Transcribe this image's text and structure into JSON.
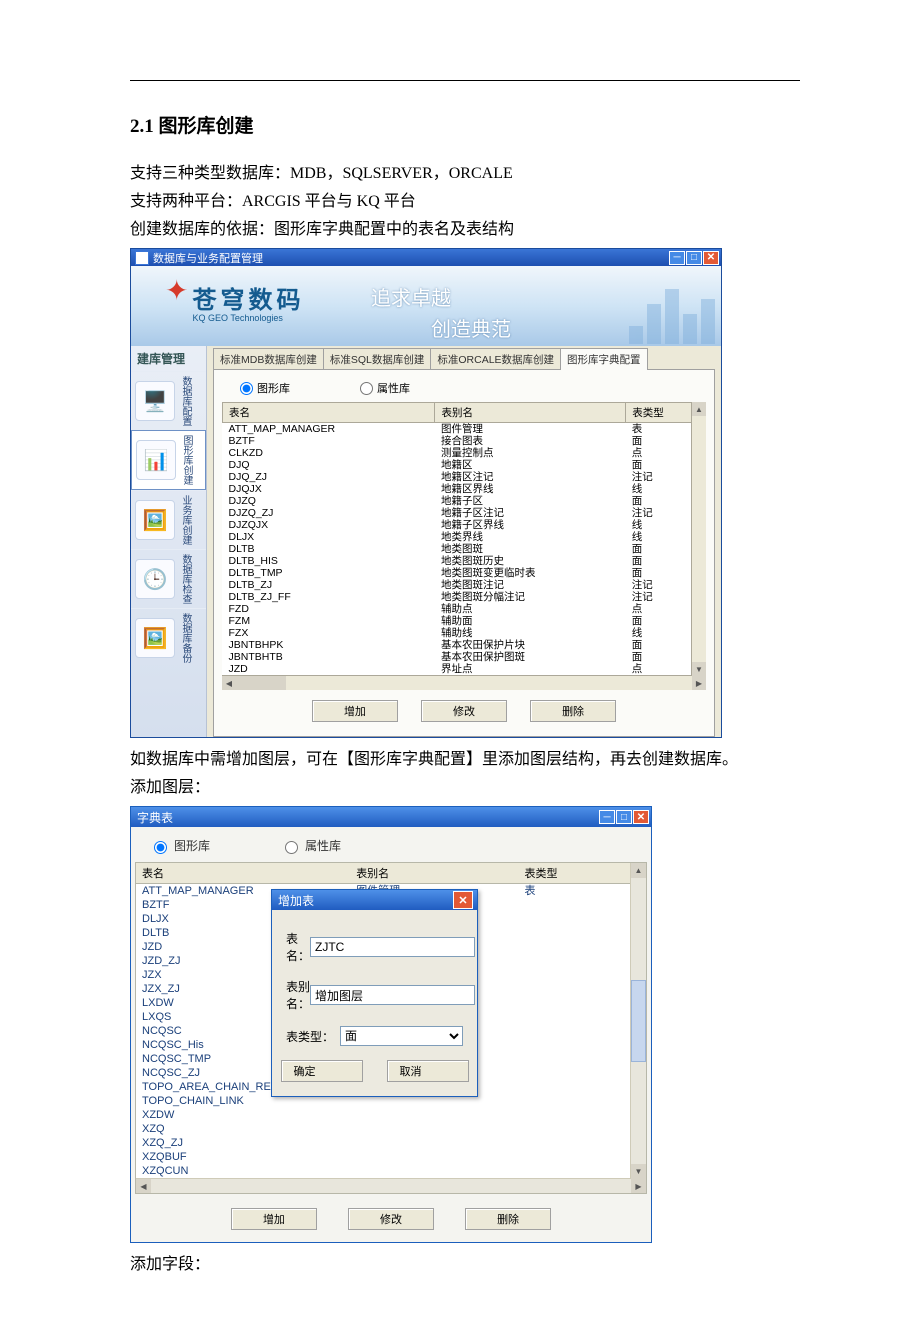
{
  "doc": {
    "section_title": "2.1 图形库创建",
    "p1": "支持三种类型数据库：MDB，SQLSERVER，ORCALE",
    "p2": "支持两种平台：ARCGIS 平台与 KQ 平台",
    "p3": "创建数据库的依据：图形库字典配置中的表名及表结构",
    "p4": "如数据库中需增加图层，可在【图形库字典配置】里添加图层结构，再去创建数据库。",
    "p5": "添加图层：",
    "p6": "添加字段："
  },
  "main_window": {
    "title": "数据库与业务配置管理",
    "logo_cn": "苍穹数码",
    "logo_en": "KQ GEO Technologies",
    "slogan1": "追求卓越",
    "slogan2": "创造典范",
    "sidebar_header": "建库管理",
    "sidebar_items": [
      {
        "label": "数据库配置"
      },
      {
        "label": "图形库创建"
      },
      {
        "label": "业务库创建"
      },
      {
        "label": "数据库检查"
      },
      {
        "label": "数据库备份"
      }
    ],
    "tabs": [
      {
        "label": "标准MDB数据库创建"
      },
      {
        "label": "标准SQL数据库创建"
      },
      {
        "label": "标准ORCALE数据库创建"
      },
      {
        "label": "图形库字典配置"
      }
    ],
    "radio_graph": "图形库",
    "radio_attr": "属性库",
    "grid": {
      "headers": [
        "表名",
        "表别名",
        "表类型"
      ],
      "rows": [
        [
          "ATT_MAP_MANAGER",
          "图件管理",
          "表"
        ],
        [
          "BZTF",
          "接合图表",
          "面"
        ],
        [
          "CLKZD",
          "测量控制点",
          "点"
        ],
        [
          "DJQ",
          "地籍区",
          "面"
        ],
        [
          "DJQ_ZJ",
          "地籍区注记",
          "注记"
        ],
        [
          "DJQJX",
          "地籍区界线",
          "线"
        ],
        [
          "DJZQ",
          "地籍子区",
          "面"
        ],
        [
          "DJZQ_ZJ",
          "地籍子区注记",
          "注记"
        ],
        [
          "DJZQJX",
          "地籍子区界线",
          "线"
        ],
        [
          "DLJX",
          "地类界线",
          "线"
        ],
        [
          "DLTB",
          "地类图斑",
          "面"
        ],
        [
          "DLTB_HIS",
          "地类图斑历史",
          "面"
        ],
        [
          "DLTB_TMP",
          "地类图斑变更临时表",
          "面"
        ],
        [
          "DLTB_ZJ",
          "地类图斑注记",
          "注记"
        ],
        [
          "DLTB_ZJ_FF",
          "地类图斑分幅注记",
          "注记"
        ],
        [
          "FZD",
          "辅助点",
          "点"
        ],
        [
          "FZM",
          "辅助面",
          "面"
        ],
        [
          "FZX",
          "辅助线",
          "线"
        ],
        [
          "JBNTBHPK",
          "基本农田保护片块",
          "面"
        ],
        [
          "JBNTBHTB",
          "基本农田保护图斑",
          "面"
        ],
        [
          "JZD",
          "界址点",
          "点"
        ]
      ]
    },
    "buttons": {
      "add": "增加",
      "edit": "修改",
      "del": "删除"
    }
  },
  "dict_window": {
    "title": "字典表",
    "radio_graph": "图形库",
    "radio_attr": "属性库",
    "grid": {
      "headers": [
        "表名",
        "表别名",
        "表类型"
      ],
      "first_row": [
        "ATT_MAP_MANAGER",
        "图件管理",
        "表"
      ],
      "name_col": [
        "BZTF",
        "DLJX",
        "DLTB",
        "JZD",
        "JZD_ZJ",
        "JZX",
        "JZX_ZJ",
        "LXDW",
        "LXQS",
        "NCQSC",
        "NCQSC_His",
        "NCQSC_TMP",
        "NCQSC_ZJ",
        "TOPO_AREA_CHAIN_REL",
        "TOPO_CHAIN_LINK",
        "XZDW",
        "XZQ",
        "XZQ_ZJ",
        "XZQBUF",
        "XZQCUN"
      ]
    },
    "buttons": {
      "add": "增加",
      "edit": "修改",
      "del": "删除"
    },
    "dialog": {
      "title": "增加表",
      "label_name": "表　名：",
      "label_alias": "表别名：",
      "label_type": "表类型：",
      "value_name": "ZJTC",
      "value_alias": "增加图层",
      "value_type": "面",
      "ok": "确定",
      "cancel": "取消"
    }
  }
}
